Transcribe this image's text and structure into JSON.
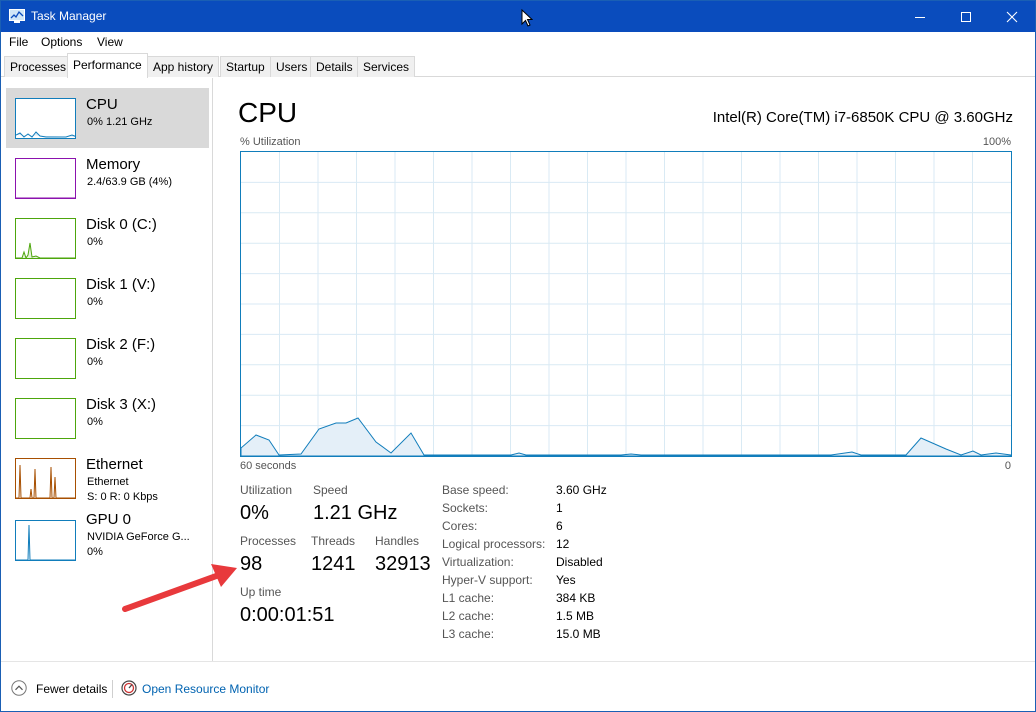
{
  "window": {
    "title": "Task Manager"
  },
  "menu": [
    "File",
    "Options",
    "View"
  ],
  "tabs": [
    "Processes",
    "Performance",
    "App history",
    "Startup",
    "Users",
    "Details",
    "Services"
  ],
  "active_tab": "Performance",
  "sidebar": {
    "items": [
      {
        "name": "CPU",
        "sub": "0%  1.21 GHz",
        "sub2": "",
        "color": "#117dbb"
      },
      {
        "name": "Memory",
        "sub": "2.4/63.9 GB (4%)",
        "sub2": "",
        "color": "#8b12ae"
      },
      {
        "name": "Disk 0 (C:)",
        "sub": "0%",
        "sub2": "",
        "color": "#4da60c"
      },
      {
        "name": "Disk 1 (V:)",
        "sub": "0%",
        "sub2": "",
        "color": "#4da60c"
      },
      {
        "name": "Disk 2 (F:)",
        "sub": "0%",
        "sub2": "",
        "color": "#4da60c"
      },
      {
        "name": "Disk 3 (X:)",
        "sub": "0%",
        "sub2": "",
        "color": "#4da60c"
      },
      {
        "name": "Ethernet",
        "sub": "Ethernet",
        "sub2": "S: 0  R: 0 Kbps",
        "color": "#a74f01"
      },
      {
        "name": "GPU 0",
        "sub": "NVIDIA GeForce G...",
        "sub2": "0%",
        "color": "#117dbb"
      }
    ]
  },
  "main": {
    "title": "CPU",
    "model": "Intel(R) Core(TM) i7-6850K CPU @ 3.60GHz",
    "graph_label": "% Utilization",
    "graph_max": "100%",
    "graph_time": "60 seconds",
    "graph_min": "0",
    "stats": {
      "utilization_label": "Utilization",
      "utilization": "0%",
      "speed_label": "Speed",
      "speed": "1.21 GHz",
      "processes_label": "Processes",
      "processes": "98",
      "threads_label": "Threads",
      "threads": "1241",
      "handles_label": "Handles",
      "handles": "32913",
      "uptime_label": "Up time",
      "uptime": "0:00:01:51"
    },
    "specs": [
      {
        "label": "Base speed:",
        "value": "3.60 GHz"
      },
      {
        "label": "Sockets:",
        "value": "1"
      },
      {
        "label": "Cores:",
        "value": "6"
      },
      {
        "label": "Logical processors:",
        "value": "12"
      },
      {
        "label": "Virtualization:",
        "value": "Disabled"
      },
      {
        "label": "Hyper-V support:",
        "value": "Yes"
      },
      {
        "label": "L1 cache:",
        "value": "384 KB"
      },
      {
        "label": "L2 cache:",
        "value": "1.5 MB"
      },
      {
        "label": "L3 cache:",
        "value": "15.0 MB"
      }
    ]
  },
  "footer": {
    "fewer_details": "Fewer details",
    "open_resource_monitor": "Open Resource Monitor"
  },
  "colors": {
    "titlebar": "#0a4cbd",
    "cpu_accent": "#117dbb",
    "annotation_arrow": "#e8393c"
  }
}
